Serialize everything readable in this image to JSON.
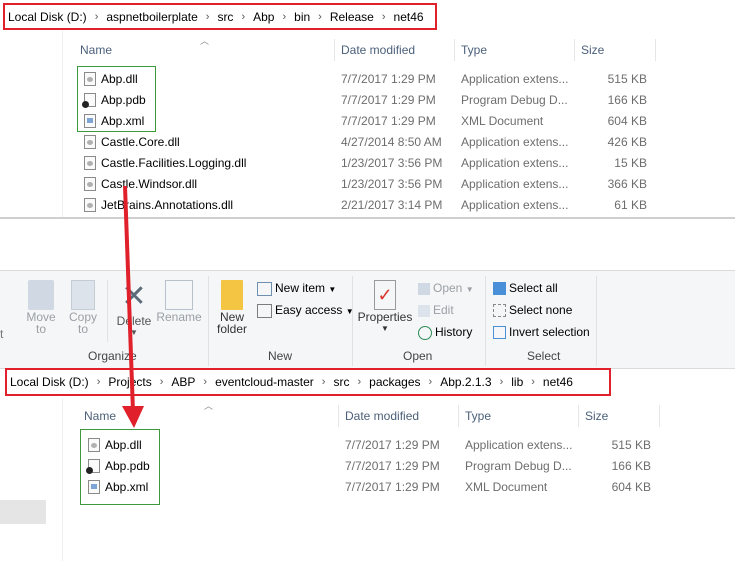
{
  "top": {
    "breadcrumb": [
      "Local Disk (D:)",
      "aspnetboilerplate",
      "src",
      "Abp",
      "bin",
      "Release",
      "net46"
    ],
    "columns": {
      "name": "Name",
      "date": "Date modified",
      "type": "Type",
      "size": "Size"
    },
    "files": [
      {
        "name": "Abp.dll",
        "date": "7/7/2017 1:29 PM",
        "type": "Application extens...",
        "size": "515 KB",
        "icon": "dll"
      },
      {
        "name": "Abp.pdb",
        "date": "7/7/2017 1:29 PM",
        "type": "Program Debug D...",
        "size": "166 KB",
        "icon": "pdb"
      },
      {
        "name": "Abp.xml",
        "date": "7/7/2017 1:29 PM",
        "type": "XML Document",
        "size": "604 KB",
        "icon": "xml"
      },
      {
        "name": "Castle.Core.dll",
        "date": "4/27/2014 8:50 AM",
        "type": "Application extens...",
        "size": "426 KB",
        "icon": "dll"
      },
      {
        "name": "Castle.Facilities.Logging.dll",
        "date": "1/23/2017 3:56 PM",
        "type": "Application extens...",
        "size": "15 KB",
        "icon": "dll"
      },
      {
        "name": "Castle.Windsor.dll",
        "date": "1/23/2017 3:56 PM",
        "type": "Application extens...",
        "size": "366 KB",
        "icon": "dll"
      },
      {
        "name": "JetBrains.Annotations.dll",
        "date": "2/21/2017 3:14 PM",
        "type": "Application extens...",
        "size": "61 KB",
        "icon": "dll"
      }
    ]
  },
  "ribbon": {
    "left_cut": "t",
    "move_to": "Move",
    "move_to_2": "to",
    "copy_to": "Copy",
    "copy_to_2": "to",
    "delete": "Delete",
    "rename": "Rename",
    "new_folder": "New",
    "new_folder_2": "folder",
    "new_item": "New item",
    "easy_access": "Easy access",
    "properties": "Properties",
    "open": "Open",
    "edit": "Edit",
    "history": "History",
    "select_all": "Select all",
    "select_none": "Select none",
    "invert_selection": "Invert selection",
    "groups": {
      "organize": "Organize",
      "new": "New",
      "open": "Open",
      "select": "Select"
    }
  },
  "bottom": {
    "breadcrumb": [
      "Local Disk (D:)",
      "Projects",
      "ABP",
      "eventcloud-master",
      "src",
      "packages",
      "Abp.2.1.3",
      "lib",
      "net46"
    ],
    "columns": {
      "name": "Name",
      "date": "Date modified",
      "type": "Type",
      "size": "Size"
    },
    "files": [
      {
        "name": "Abp.dll",
        "date": "7/7/2017 1:29 PM",
        "type": "Application extens...",
        "size": "515 KB",
        "icon": "dll"
      },
      {
        "name": "Abp.pdb",
        "date": "7/7/2017 1:29 PM",
        "type": "Program Debug D...",
        "size": "166 KB",
        "icon": "pdb"
      },
      {
        "name": "Abp.xml",
        "date": "7/7/2017 1:29 PM",
        "type": "XML Document",
        "size": "604 KB",
        "icon": "xml"
      }
    ]
  },
  "colors": {
    "highlight_red": "#e0202a",
    "highlight_green": "#3c9a3c",
    "header_text": "#4c607a"
  }
}
